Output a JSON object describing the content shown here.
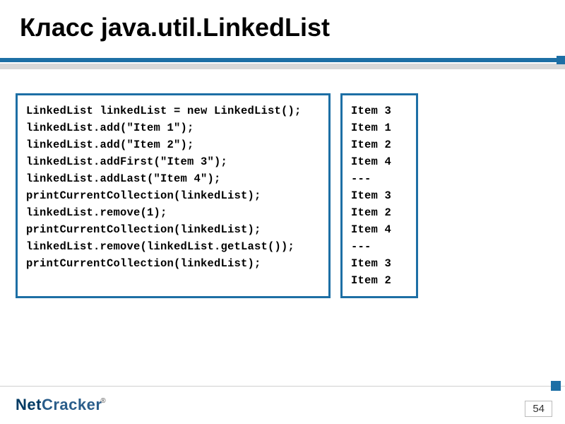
{
  "title": "Класс java.util.LinkedList",
  "code": {
    "left": [
      "LinkedList linkedList = new LinkedList();",
      "linkedList.add(\"Item 1\");",
      "linkedList.add(\"Item 2\");",
      "linkedList.addFirst(\"Item 3\");",
      "linkedList.addLast(\"Item 4\");",
      "printCurrentCollection(linkedList);",
      "",
      "linkedList.remove(1);",
      "printCurrentCollection(linkedList);",
      "",
      "linkedList.remove(linkedList.getLast());",
      "printCurrentCollection(linkedList);"
    ],
    "right": [
      "Item 3",
      "Item 1",
      "Item 2",
      "Item 4",
      "---",
      "Item 3",
      "Item 2",
      "Item 4",
      "---",
      "Item 3",
      "Item 2"
    ]
  },
  "brand": {
    "part1": "Net",
    "part2": "Cracker",
    "reg": "®"
  },
  "page_number": "54"
}
